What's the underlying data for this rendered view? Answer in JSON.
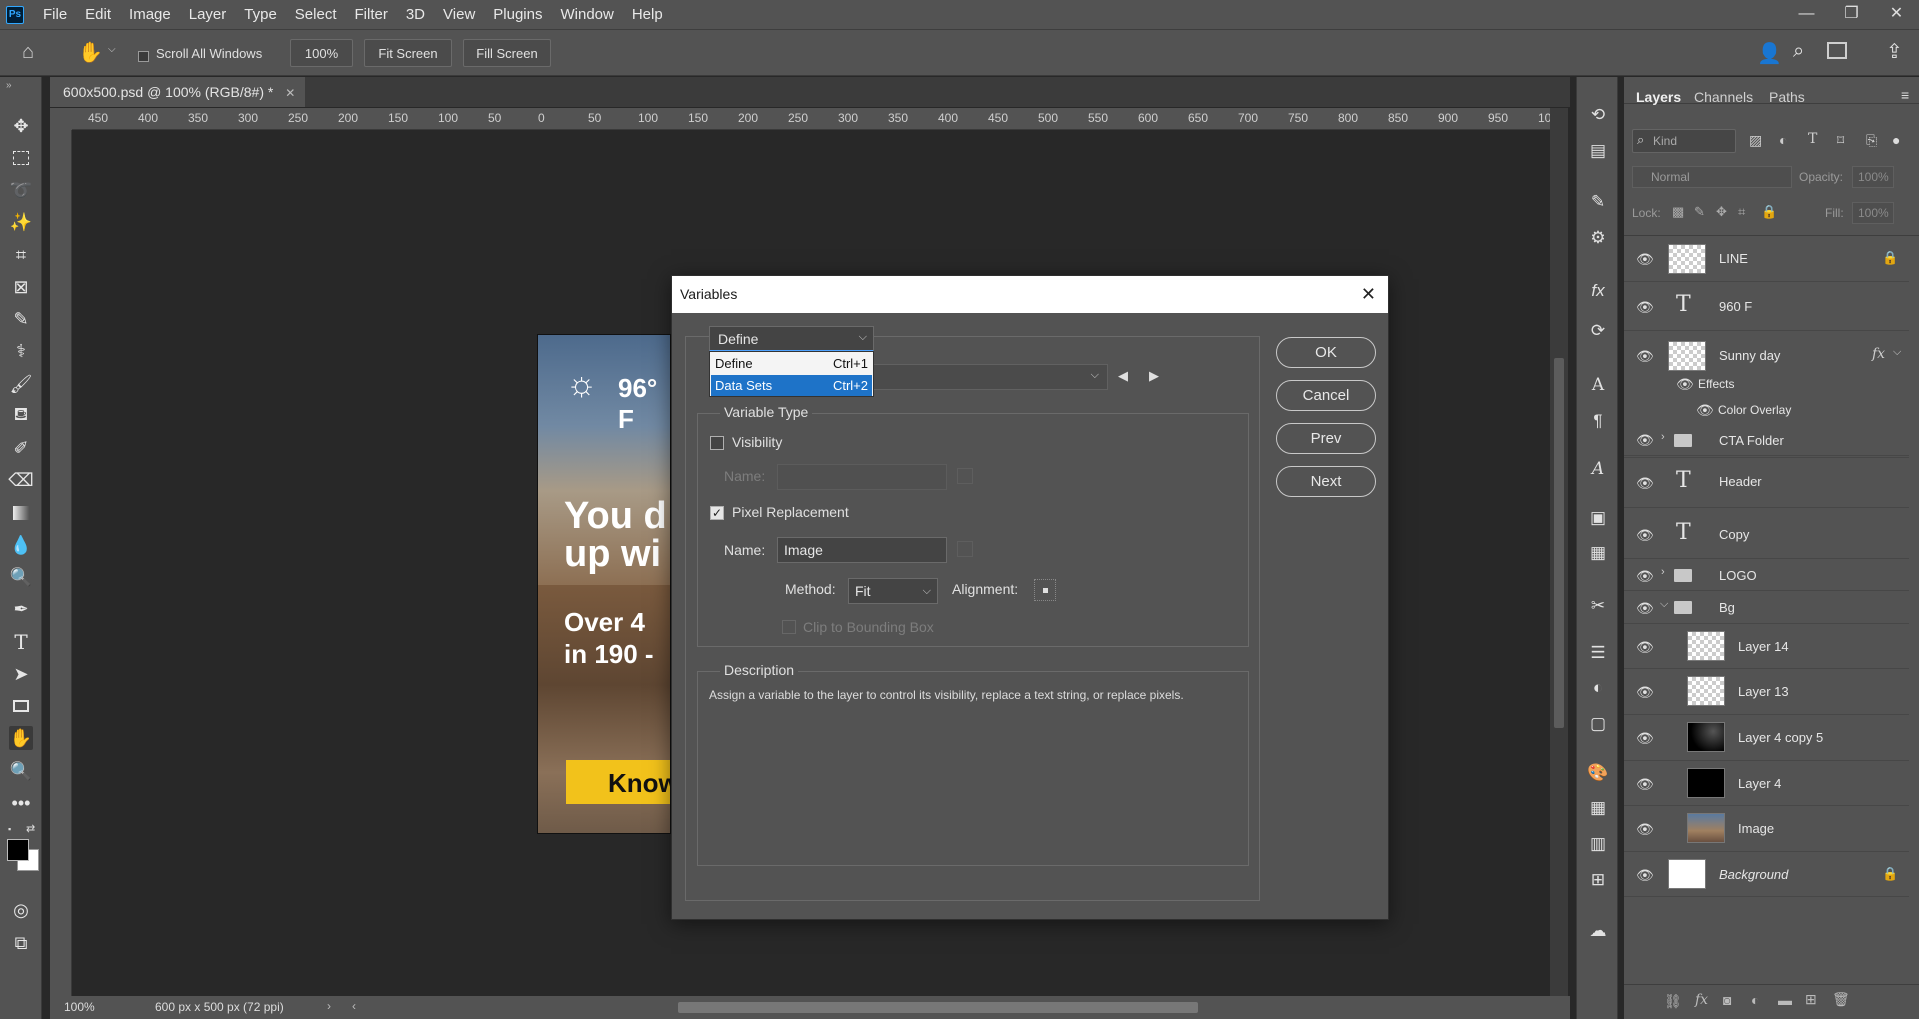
{
  "app": {
    "logo": "Ps",
    "menu": [
      "File",
      "Edit",
      "Image",
      "Layer",
      "Type",
      "Select",
      "Filter",
      "3D",
      "View",
      "Plugins",
      "Window",
      "Help"
    ]
  },
  "options": {
    "scroll_all_windows": "Scroll All Windows",
    "zoom": "100%",
    "fit_screen": "Fit Screen",
    "fill_screen": "Fill Screen"
  },
  "document": {
    "tab_title": "600x500.psd @ 100% (RGB/8#) *",
    "ruler_labels": [
      "450",
      "400",
      "350",
      "300",
      "250",
      "200",
      "150",
      "100",
      "50",
      "0",
      "50",
      "100",
      "150",
      "200",
      "250",
      "300",
      "350",
      "400",
      "450",
      "500",
      "550",
      "600",
      "650",
      "700",
      "750",
      "800",
      "850",
      "900",
      "950",
      "10("
    ],
    "canvas_texts": {
      "weather": "96° F",
      "headline_1": "You d",
      "headline_2": "up wi",
      "copy_1": "Over 4",
      "copy_2": "in 190 -",
      "cta": "Know"
    }
  },
  "status": {
    "zoom": "100%",
    "doc_info": "600 px x 500 px (72 ppi)"
  },
  "layers_panel": {
    "tabs": [
      "Layers",
      "Channels",
      "Paths"
    ],
    "kind_placeholder": "Kind",
    "blend_mode": "Normal",
    "opacity_label": "Opacity:",
    "opacity_value": "100%",
    "lock_label": "Lock:",
    "fill_label": "Fill:",
    "fill_value": "100%",
    "layers": [
      {
        "name": "LINE"
      },
      {
        "name": "960 F"
      },
      {
        "name": "Sunny day"
      },
      {
        "name": "Effects"
      },
      {
        "name": "Color Overlay"
      },
      {
        "name": "CTA Folder"
      },
      {
        "name": "Header"
      },
      {
        "name": "Copy"
      },
      {
        "name": "LOGO"
      },
      {
        "name": "Bg"
      },
      {
        "name": "Layer 14"
      },
      {
        "name": "Layer 13"
      },
      {
        "name": "Layer 4 copy 5"
      },
      {
        "name": "Layer 4"
      },
      {
        "name": "Image"
      },
      {
        "name": "Background"
      }
    ]
  },
  "dialog": {
    "title": "Variables",
    "mode_select": "Define",
    "dropdown": [
      {
        "label": "Define",
        "shortcut": "Ctrl+1"
      },
      {
        "label": "Data Sets",
        "shortcut": "Ctrl+2"
      }
    ],
    "variable_type_legend": "Variable Type",
    "visibility_label": "Visibility",
    "name_label": "Name:",
    "pixel_replacement_label": "Pixel Replacement",
    "pixel_name_value": "Image",
    "method_label": "Method:",
    "method_value": "Fit",
    "alignment_label": "Alignment:",
    "clip_label": "Clip to Bounding Box",
    "description_legend": "Description",
    "description_text": "Assign a variable to the layer to control its visibility, replace a text string, or replace pixels.",
    "buttons": {
      "ok": "OK",
      "cancel": "Cancel",
      "prev": "Prev",
      "next": "Next"
    }
  }
}
